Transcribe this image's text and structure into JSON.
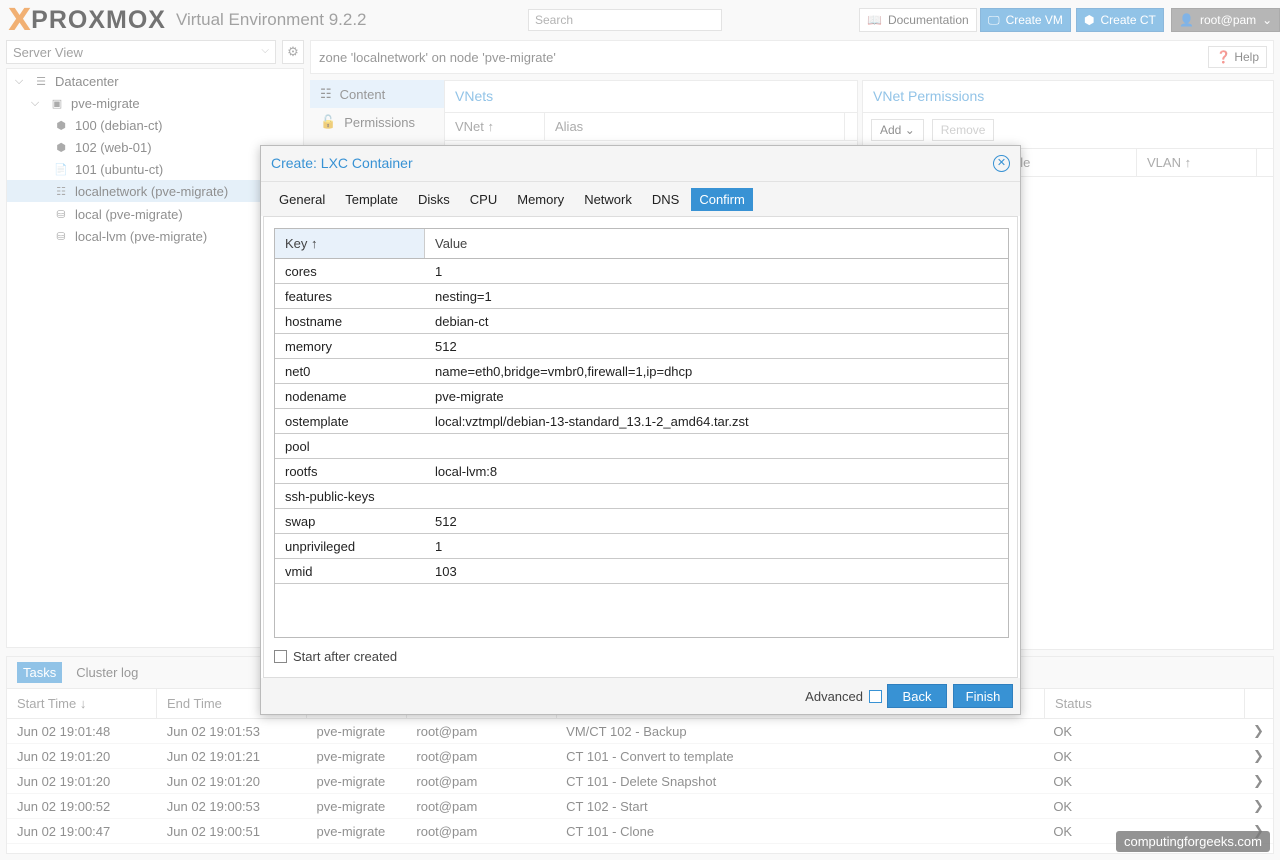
{
  "app": {
    "logo_x": "X",
    "logo_word": "PROXMOX",
    "version": "Virtual Environment 9.2.2",
    "search_placeholder": "Search",
    "documentation": "Documentation",
    "create_vm": "Create VM",
    "create_ct": "Create CT",
    "user": "root@pam"
  },
  "sidebar": {
    "view": "Server View",
    "tree": [
      {
        "label": "Datacenter",
        "icon": "server-rack-icon"
      },
      {
        "label": "pve-migrate",
        "icon": "node-icon"
      },
      {
        "label": "100 (debian-ct)",
        "icon": "container-icon"
      },
      {
        "label": "102 (web-01)",
        "icon": "container-icon"
      },
      {
        "label": "101 (ubuntu-ct)",
        "icon": "template-icon"
      },
      {
        "label": "localnetwork (pve-migrate)",
        "icon": "grid-icon"
      },
      {
        "label": "local (pve-migrate)",
        "icon": "storage-icon"
      },
      {
        "label": "local-lvm (pve-migrate)",
        "icon": "storage-icon"
      }
    ]
  },
  "content": {
    "breadcrumb": "zone 'localnetwork' on node 'pve-migrate'",
    "help": "Help",
    "nav": [
      {
        "label": "Content",
        "icon": "grid-icon"
      },
      {
        "label": "Permissions",
        "icon": "unlock-icon"
      }
    ],
    "vnets": {
      "title": "VNets",
      "col_vnet": "VNet",
      "col_alias": "Alias"
    },
    "perm": {
      "title": "VNet Permissions",
      "add": "Add",
      "remove": "Remove",
      "col_bridge": "ble",
      "col_vlan": "VLAN"
    }
  },
  "modal": {
    "title": "Create: LXC Container",
    "tabs": [
      "General",
      "Template",
      "Disks",
      "CPU",
      "Memory",
      "Network",
      "DNS",
      "Confirm"
    ],
    "active_tab": "Confirm",
    "col_key": "Key",
    "col_value": "Value",
    "rows": [
      {
        "key": "cores",
        "value": "1"
      },
      {
        "key": "features",
        "value": "nesting=1"
      },
      {
        "key": "hostname",
        "value": "debian-ct"
      },
      {
        "key": "memory",
        "value": "512"
      },
      {
        "key": "net0",
        "value": "name=eth0,bridge=vmbr0,firewall=1,ip=dhcp"
      },
      {
        "key": "nodename",
        "value": "pve-migrate"
      },
      {
        "key": "ostemplate",
        "value": "local:vztmpl/debian-13-standard_13.1-2_amd64.tar.zst"
      },
      {
        "key": "pool",
        "value": ""
      },
      {
        "key": "rootfs",
        "value": "local-lvm:8"
      },
      {
        "key": "ssh-public-keys",
        "value": ""
      },
      {
        "key": "swap",
        "value": "512"
      },
      {
        "key": "unprivileged",
        "value": "1"
      },
      {
        "key": "vmid",
        "value": "103"
      }
    ],
    "start_after": "Start after created",
    "advanced": "Advanced",
    "back": "Back",
    "finish": "Finish"
  },
  "tasks": {
    "tabs": [
      "Tasks",
      "Cluster log"
    ],
    "headers": [
      "Start Time",
      "End Time",
      "",
      "",
      "",
      "Status"
    ],
    "rows": [
      {
        "start": "Jun 02 19:01:48",
        "end": "Jun 02 19:01:53",
        "node": "pve-migrate",
        "user": "root@pam",
        "desc": "VM/CT 102 - Backup",
        "status": "OK"
      },
      {
        "start": "Jun 02 19:01:20",
        "end": "Jun 02 19:01:21",
        "node": "pve-migrate",
        "user": "root@pam",
        "desc": "CT 101 - Convert to template",
        "status": "OK"
      },
      {
        "start": "Jun 02 19:01:20",
        "end": "Jun 02 19:01:20",
        "node": "pve-migrate",
        "user": "root@pam",
        "desc": "CT 101 - Delete Snapshot",
        "status": "OK"
      },
      {
        "start": "Jun 02 19:00:52",
        "end": "Jun 02 19:00:53",
        "node": "pve-migrate",
        "user": "root@pam",
        "desc": "CT 102 - Start",
        "status": "OK"
      },
      {
        "start": "Jun 02 19:00:47",
        "end": "Jun 02 19:00:51",
        "node": "pve-migrate",
        "user": "root@pam",
        "desc": "CT 101 - Clone",
        "status": "OK"
      }
    ]
  },
  "watermark": "computingforgeeks.com",
  "colors": {
    "accent": "#3892d4",
    "logo_orange": "#e57000"
  }
}
